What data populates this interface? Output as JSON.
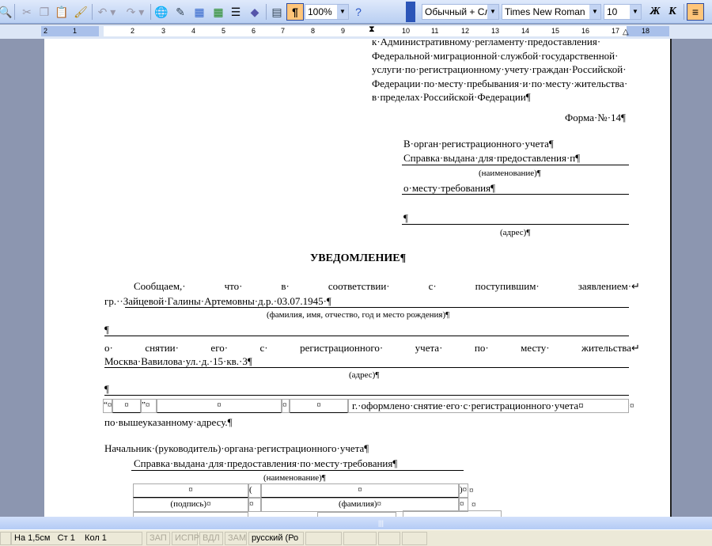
{
  "toolbar": {
    "zoom": "100%",
    "style": "Обычный + Сле",
    "font": "Times New Roman",
    "size": "10",
    "bold": "Ж",
    "italic": "К",
    "icons": [
      "print-preview-icon",
      "cut-icon",
      "copy-icon",
      "paste-icon",
      "format-painter-icon",
      "undo-icon",
      "redo-icon",
      "hyperlink-icon",
      "tables-borders-icon",
      "insert-table-icon",
      "insert-excel-icon",
      "columns-icon",
      "drawing-icon",
      "document-map-icon",
      "show-formatting-icon",
      "help-icon",
      "align-left-icon"
    ]
  },
  "ruler": {
    "labels": [
      "2",
      "1",
      "1",
      "2",
      "3",
      "4",
      "5",
      "6",
      "7",
      "8",
      "9",
      "10",
      "11",
      "12",
      "13",
      "14",
      "15",
      "16",
      "17",
      "18"
    ]
  },
  "document": {
    "header_lines": [
      "к·Административному·регламенту·предоставления·",
      "Федеральной·миграционной·службой·государственной·",
      "услуги·по·регистрационному·учету·граждан·Российской·",
      "Федерации·по·месту·пребывания·и·по·месту·жительства·",
      "в·пределах·Российской·Федерации¶"
    ],
    "form_number": "Форма·№·14¶",
    "to_organ": "В·орган·регистрационного·учета¶",
    "to_line1": "Справка·выдана·для·предоставления·п¶",
    "naimenovanie": "(наименование)¶",
    "to_line2": "о·месту·требования¶",
    "empty_para": "¶",
    "adres": "(адрес)¶",
    "title": "УВЕДОМЛЕНИЕ¶",
    "p1_words": [
      "Сообщаем,·",
      "что·",
      "в·",
      "соответствии·",
      "с·",
      "поступившим·",
      "заявлением·↵"
    ],
    "p1_name": "гр.··Зайцевой·Галины·Артемовны·д.р.·03.07.1945·¶",
    "fio_caption": "(фамилия, имя, отчество, год и место рождения)¶",
    "p2_words": [
      "о·",
      "снятии·",
      "его·",
      "с·",
      "регистрационного·",
      "учета·",
      "по·",
      "месту·",
      "жительства↵"
    ],
    "p2_address": "Москва·Вавилова·ул.·д.·15·кв.·3¶",
    "adres2": "(адрес)¶",
    "date_row": {
      "q_open": "“¤",
      "q_close": "”¤",
      "cell": "¤",
      "text": "г.·оформлено·снятие·его·с·регистрационного·учета¤",
      "end": "¤"
    },
    "p3": "по·вышеуказанному·адресу.¶",
    "chief": "Начальник·(руководитель)·органа·регистрационного·учета¶",
    "chief_line": "Справка·выдана·для·предоставления·по·месту·требования¶",
    "naimenovanie2": "(наименование)¶",
    "sign_table": {
      "cell": "¤",
      "paren_open": "(",
      "paren_close": ")¤",
      "end": "¤",
      "podpis": "(подпись)¤",
      "familia": "(фамилия)¤"
    }
  },
  "status": {
    "position": "На 1,5см",
    "line": "Ст 1",
    "col": "Кол 1",
    "rec": "ЗАП",
    "trk": "ИСПР",
    "ext": "ВДЛ",
    "ovr": "ЗАМ",
    "lang": "русский (Ро"
  }
}
